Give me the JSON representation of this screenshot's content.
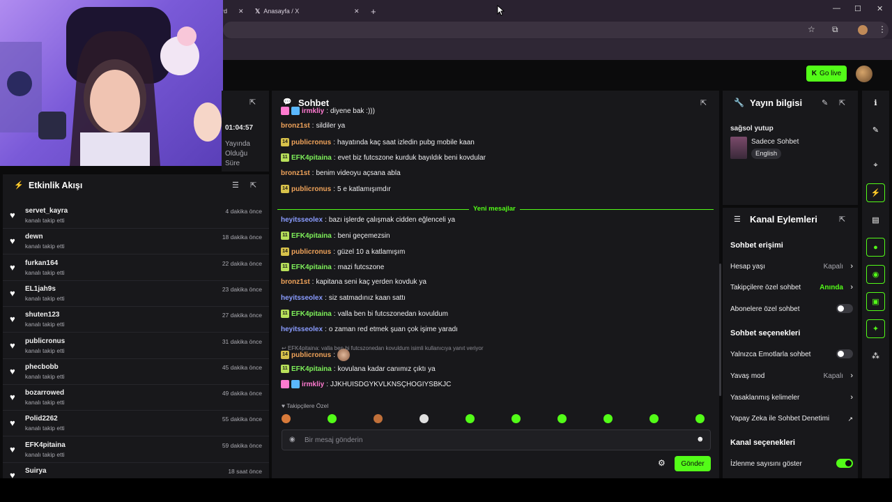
{
  "browser": {
    "tab_partial_label": "rd",
    "tab_x_label": "Anasayfa / X",
    "new_tab_glyph": "+"
  },
  "header": {
    "go_live_label": "Go live"
  },
  "stream_stats": {
    "uptime": "01:04:57",
    "uptime_label_lines": [
      "Yayında",
      "Olduğu",
      "Süre"
    ]
  },
  "activity": {
    "title": "Etkinlik Akışı",
    "items": [
      {
        "name": "servet_kayra",
        "sub": "kanalı takip etti",
        "time": "4 dakika önce"
      },
      {
        "name": "dewn",
        "sub": "kanalı takip etti",
        "time": "18 dakika önce"
      },
      {
        "name": "furkan164",
        "sub": "kanalı takip etti",
        "time": "22 dakika önce"
      },
      {
        "name": "EL1jah9s",
        "sub": "kanalı takip etti",
        "time": "23 dakika önce"
      },
      {
        "name": "shuten123",
        "sub": "kanalı takip etti",
        "time": "27 dakika önce"
      },
      {
        "name": "publicronus",
        "sub": "kanalı takip etti",
        "time": "31 dakika önce"
      },
      {
        "name": "phecbobb",
        "sub": "kanalı takip etti",
        "time": "45 dakika önce"
      },
      {
        "name": "bozarrowed",
        "sub": "kanalı takip etti",
        "time": "49 dakika önce"
      },
      {
        "name": "Polid2262",
        "sub": "kanalı takip etti",
        "time": "55 dakika önce"
      },
      {
        "name": "EFK4pitaina",
        "sub": "kanalı takip etti",
        "time": "59 dakika önce"
      },
      {
        "name": "Suirya",
        "sub": "",
        "time": "18 saat önce"
      }
    ]
  },
  "chat": {
    "title": "Sohbet",
    "new_messages_label": "Yeni mesajlar",
    "messages": [
      {
        "badge": "",
        "user": "irmkliy",
        "text": "diyene bak :)))",
        "color": "pk"
      },
      {
        "badge": "",
        "user": "bronz1st",
        "text": "sildiler ya",
        "color": "or"
      },
      {
        "badge": "14",
        "user": "publicronus",
        "text": "hayatında kaç saat izledin pubg mobile kaan",
        "color": "or"
      },
      {
        "badge": "11",
        "user": "EFK4pitaina",
        "text": "evet biz futcszone kurduk bayıldık beni kovdular",
        "color": "gr"
      },
      {
        "badge": "",
        "user": "bronz1st",
        "text": "benim videoyu açsana abla",
        "color": "or"
      },
      {
        "badge": "14",
        "user": "publicronus",
        "text": "5 e katlamışımdır",
        "color": "or"
      },
      {
        "badge": "",
        "user": "heyitsseolex",
        "text": "bazı işlerde çalışmak cidden eğlenceli ya",
        "color": "bl"
      },
      {
        "badge": "11",
        "user": "EFK4pitaina",
        "text": "beni geçemezsin",
        "color": "gr"
      },
      {
        "badge": "14",
        "user": "publicronus",
        "text": "güzel 10 a katlamışım",
        "color": "or"
      },
      {
        "badge": "11",
        "user": "EFK4pitaina",
        "text": "mazi futcszone",
        "color": "gr"
      },
      {
        "badge": "",
        "user": "bronz1st",
        "text": "kapitana seni kaç yerden kovduk ya",
        "color": "or"
      },
      {
        "badge": "",
        "user": "heyitsseolex",
        "text": "siz satmadınız kaan sattı",
        "color": "bl"
      },
      {
        "badge": "11",
        "user": "EFK4pitaina",
        "text": "valla ben bi futcszonedan kovuldum",
        "color": "gr"
      },
      {
        "badge": "",
        "user": "heyitsseolex",
        "text": "o zaman red etmek şuan çok işime yaradı",
        "color": "bl"
      },
      {
        "badge": "14",
        "user": "publicronus",
        "text": "",
        "color": "or"
      },
      {
        "badge": "11",
        "user": "EFK4pitaina",
        "text": "kovulana kadar canımız çıktı ya",
        "color": "gr"
      },
      {
        "badge": "",
        "user": "irmkliy",
        "text": "JJKHUISDGYKVLKNSÇHOGIYSBKJC",
        "color": "pk"
      }
    ],
    "reply_hint": "EFK4pitaina: valla ben bi futcszonedan kovuldum isimli kullanıcıya yanıt veriyor",
    "followers_only_label": "Takipçilere Özel",
    "input_placeholder": "Bir mesaj gönderin",
    "send_label": "Gönder"
  },
  "stream_info": {
    "title": "Yayın bilgisi",
    "stream_title": "sağsol yutup",
    "category": "Sadece Sohbet",
    "language": "English"
  },
  "channel_actions": {
    "title": "Kanal Eylemleri",
    "chat_access_heading": "Sohbet erişimi",
    "age_label": "Hesap yaşı",
    "age_value": "Kapalı",
    "followers_label": "Takipçilere özel sohbet",
    "followers_value": "Anında",
    "subs_label": "Abonelere özel sohbet",
    "chat_options_heading": "Sohbet seçenekleri",
    "emote_only_label": "Yalnızca Emotlarla sohbet",
    "slow_label": "Yavaş mod",
    "slow_value": "Kapalı",
    "banned_words_label": "Yasaklanmış kelimeler",
    "ai_moderation_label": "Yapay Zeka ile Sohbet Denetimi",
    "channel_options_heading": "Kanal seçenekleri",
    "viewer_count_label": "İzlenme sayısını göster"
  },
  "colors": {
    "accent": "#53fc18",
    "panel": "#18181b",
    "background": "#0b0b0c"
  }
}
